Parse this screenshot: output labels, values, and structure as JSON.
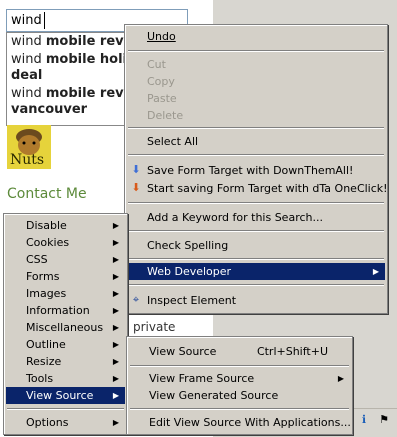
{
  "search": {
    "value": "wind"
  },
  "suggestions": [
    {
      "prefix": "wind ",
      "bold": "mobile review"
    },
    {
      "prefix": "wind ",
      "bold": "mobile holiday",
      "line2": "deal"
    },
    {
      "prefix": "wind ",
      "bold": "mobile review",
      "line2": "vancouver"
    }
  ],
  "logo": {
    "label": "Nuts"
  },
  "page": {
    "contact": "Contact Me",
    "private": "private"
  },
  "context_menu": {
    "undo": "Undo",
    "cut": "Cut",
    "copy": "Copy",
    "paste": "Paste",
    "delete": "Delete",
    "select_all": "Select All",
    "save_dta": "Save Form Target with DownThemAll!",
    "save_oneclick": "Start saving Form Target with dTa OneClick!",
    "add_keyword": "Add a Keyword for this Search...",
    "check_spelling": "Check Spelling",
    "web_developer": "Web Developer",
    "inspect": "Inspect Element"
  },
  "webdev_menu": {
    "items": [
      "Disable",
      "Cookies",
      "CSS",
      "Forms",
      "Images",
      "Information",
      "Miscellaneous",
      "Outline",
      "Resize",
      "Tools",
      "View Source"
    ],
    "options": "Options"
  },
  "source_menu": {
    "view_source": "View Source",
    "view_source_shortcut": "Ctrl+Shift+U",
    "view_frame_source": "View Frame Source",
    "view_generated_source": "View Generated Source",
    "view_source_apps": "Edit View Source With Applications..."
  },
  "colors": {
    "selection": "#0a246a",
    "menu_bg": "#d4d0c8",
    "disabled": "#9a978e"
  }
}
